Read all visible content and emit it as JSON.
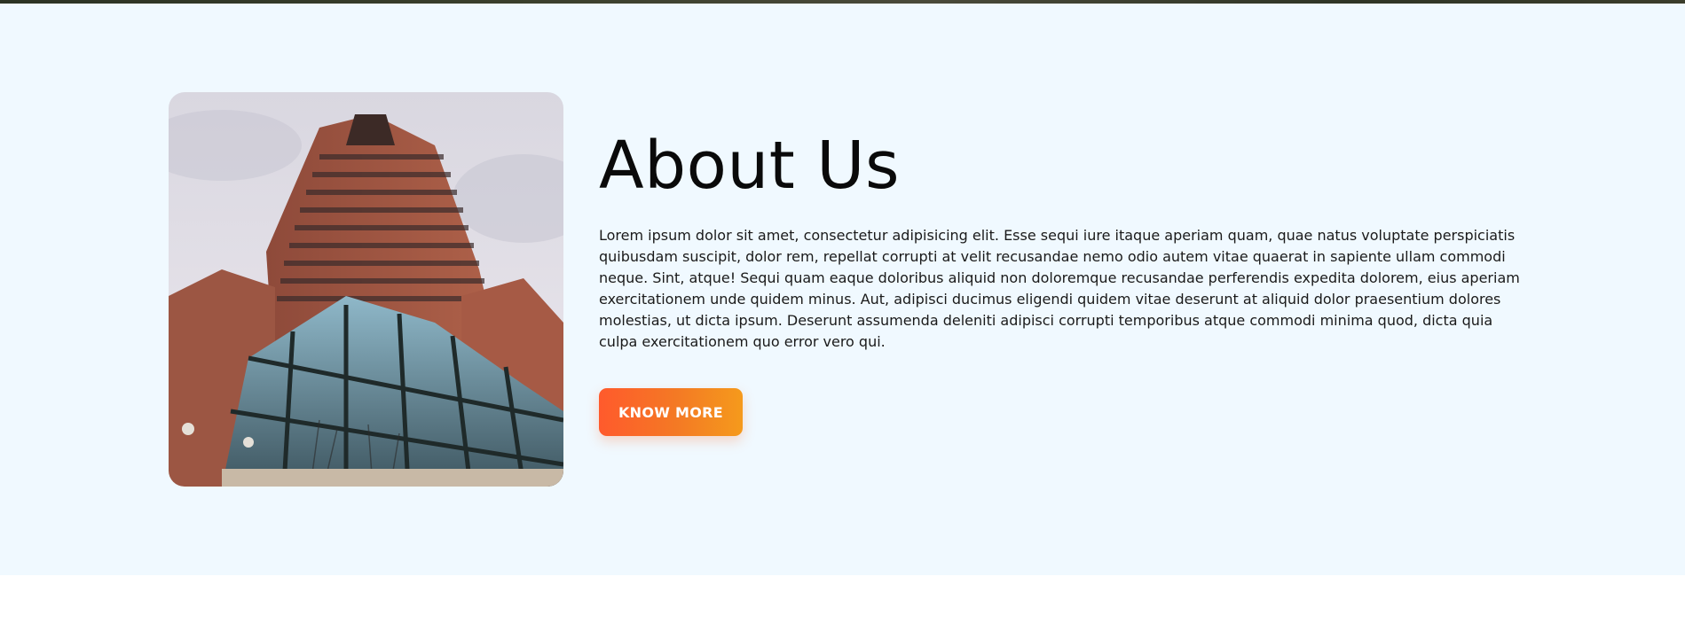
{
  "about": {
    "title": "About Us",
    "paragraph": "Lorem ipsum dolor sit amet, consectetur adipisicing elit. Esse sequi iure itaque aperiam quam, quae natus voluptate perspiciatis quibusdam suscipit, dolor rem, repellat corrupti at velit recusandae nemo odio autem vitae quaerat in sapiente ullam commodi neque. Sint, atque! Sequi quam eaque doloribus aliquid non doloremque recusandae perferendis expedita dolorem, eius aperiam exercitationem unde quidem minus. Aut, adipisci ducimus eligendi quidem vitae deserunt at aliquid dolor praesentium dolores molestias, ut dicta ipsum. Deserunt assumenda deleniti adipisci corrupti temporibus atque commodi minima quod, dicta quia culpa exercitationem quo error vero qui.",
    "button_label": "KNOW MORE"
  },
  "colors": {
    "section_background": "#f0f9ff",
    "button_gradient_start": "#ff5a2c",
    "button_gradient_end": "#f59a1c",
    "title_color": "#0a0a0a"
  }
}
